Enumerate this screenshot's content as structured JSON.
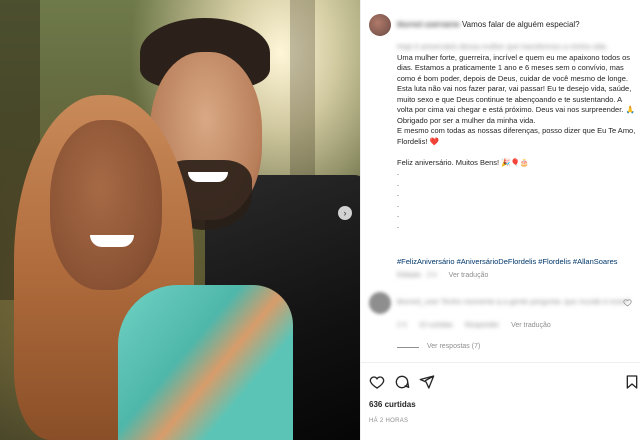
{
  "caption": {
    "username": "blurred username",
    "header_text": "Vamos falar de alguém especial?",
    "intro": "Hoje é aniversário dessa mulher que transformou a minha vida.",
    "body": "Uma mulher forte, guerreira, incrível e quem eu me apaixono todos os dias. Estamos a praticamente 1 ano e 6 meses sem o convívio, mas como é bom poder, depois de Deus, cuidar de você mesmo de longe. Esta luta não vai nos fazer parar, vai passar! Eu te desejo vida, saúde, muito sexo e que Deus continue te abençoando e te sustentando. A volta por cima vai chegar e está próximo. Deus vai nos surpreender. 🙏\nObrigado por ser a mulher da minha vida.\nE mesmo com todas as nossas diferenças, posso dizer que Eu Te Amo, Flordelis! ❤️\n\nFeliz aniversário. Muitos Bens! 🎉🎈🎂\n.\n.\n.\n.\n.\n.",
    "hashtags": "#FelizAniversário #AniversárioDeFlordelis #Flordelis #AllanSoares",
    "edited": "Editado · 2 h",
    "see_translation": "Ver tradução"
  },
  "comment": {
    "text": "blurred_user Tenho momento q a gente pergunta: que mundo é esse?",
    "time": "2 h",
    "likes": "10 curtidas",
    "reply": "Responder",
    "see_translation": "Ver tradução",
    "view_replies": "Ver respostas (7)",
    "heart_icon": "heart-outline"
  },
  "actions": {
    "like_icon": "heart-outline",
    "comment_icon": "speech-bubble",
    "share_icon": "paper-plane",
    "save_icon": "bookmark"
  },
  "likes_count": "636 curtidas",
  "timestamp": "HÁ 2 HORAS",
  "carousel_next": "›"
}
